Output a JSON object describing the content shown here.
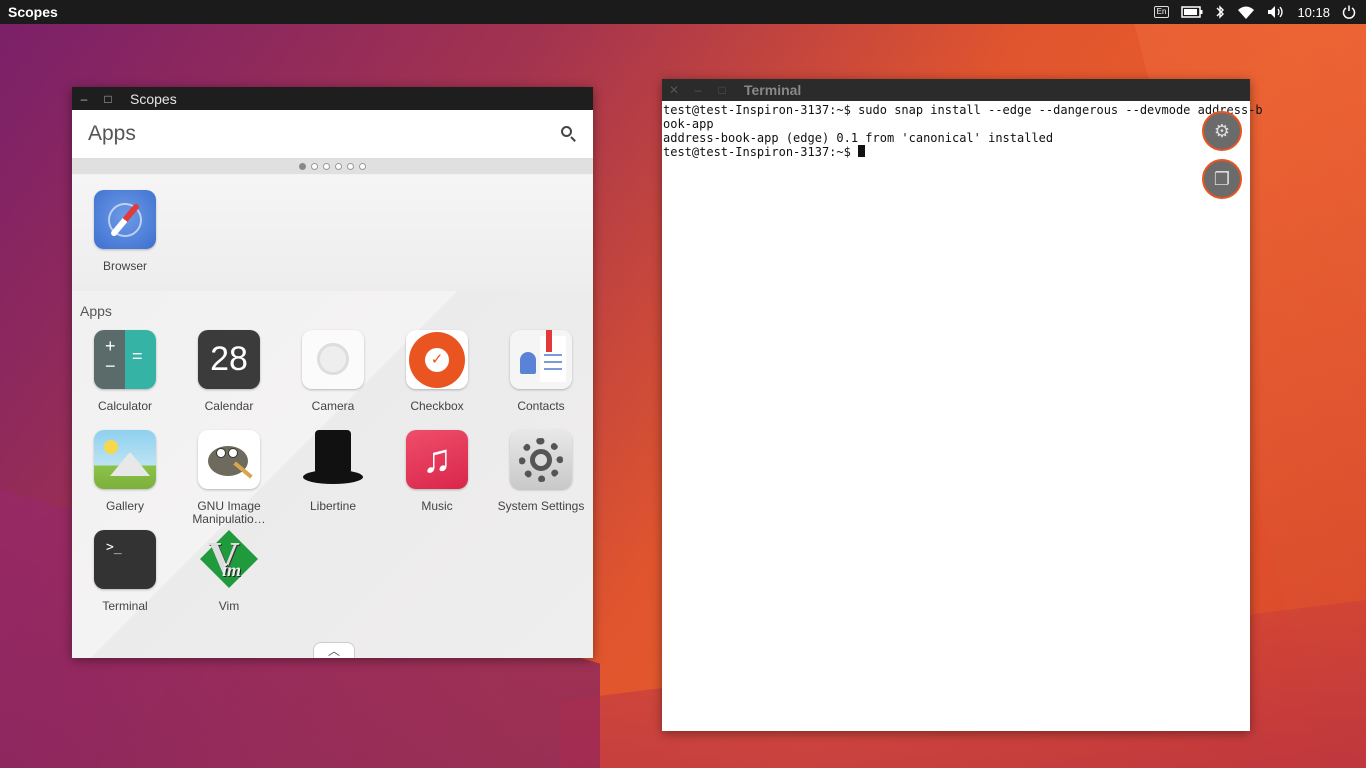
{
  "panel": {
    "app_title": "Scopes",
    "keyboard": "En",
    "clock": "10:18"
  },
  "scopes_window": {
    "title": "Scopes",
    "header_title": "Apps",
    "page_count": 6,
    "active_page": 0,
    "favorites": [
      {
        "label": "Browser",
        "icon": "browser-icon"
      }
    ],
    "section_label": "Apps",
    "apps": [
      {
        "label": "Calculator",
        "icon": "calculator-icon"
      },
      {
        "label": "Calendar",
        "icon": "calendar-icon",
        "icon_text": "28"
      },
      {
        "label": "Camera",
        "icon": "camera-icon"
      },
      {
        "label": "Checkbox",
        "icon": "checkbox-icon"
      },
      {
        "label": "Contacts",
        "icon": "contacts-icon"
      },
      {
        "label": "Gallery",
        "icon": "gallery-icon"
      },
      {
        "label": "GNU Image Manipulatio…",
        "icon": "gimp-icon"
      },
      {
        "label": "Libertine",
        "icon": "libertine-icon"
      },
      {
        "label": "Music",
        "icon": "music-icon"
      },
      {
        "label": "System Settings",
        "icon": "settings-icon"
      },
      {
        "label": "Terminal",
        "icon": "terminal-icon"
      },
      {
        "label": "Vim",
        "icon": "vim-icon"
      }
    ]
  },
  "terminal_window": {
    "title": "Terminal",
    "lines": [
      "test@test-Inspiron-3137:~$ sudo snap install --edge --dangerous --devmode address-b",
      "ook-app",
      "address-book-app (edge) 0.1 from 'canonical' installed"
    ],
    "prompt": "test@test-Inspiron-3137:~$ "
  },
  "colors": {
    "accent": "#e95420",
    "panel_bg": "#1b1b1b"
  }
}
